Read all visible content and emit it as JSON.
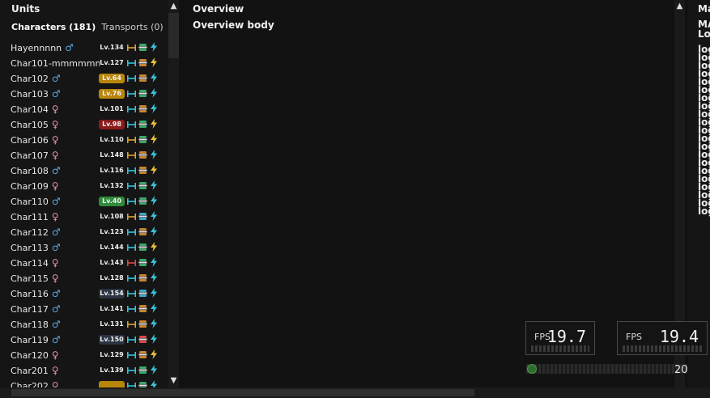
{
  "left_panel": {
    "title": "Units",
    "tabs": {
      "characters": "Characters (181)",
      "transports": "Transports (0)"
    },
    "scroll_up": "▲",
    "scroll_down": "▼"
  },
  "characters": [
    {
      "name": "Hayennnnn",
      "gender": "♂",
      "level": "Lv.134",
      "badge": "none",
      "range_color": "#d9a23a",
      "food_color": "#3aa86a",
      "bolt_color": "#39c2d8"
    },
    {
      "name": "Char101-mmmmmmmmm",
      "gender": "♂",
      "level": "Lv.127",
      "badge": "none",
      "range_color": "#39c2d8",
      "food_color": "#c8832f",
      "bolt_color": "#e8c23a"
    },
    {
      "name": "Char102",
      "gender": "♂",
      "level": "Lv.64",
      "badge": "gold",
      "range_color": "#39c2d8",
      "food_color": "#c8832f",
      "bolt_color": "#39c2d8"
    },
    {
      "name": "Char103",
      "gender": "♂",
      "level": "Lv.76",
      "badge": "gold",
      "range_color": "#39c2d8",
      "food_color": "#3aa86a",
      "bolt_color": "#39c2d8"
    },
    {
      "name": "Char104",
      "gender": "♀",
      "level": "Lv.101",
      "badge": "none",
      "range_color": "#39c2d8",
      "food_color": "#c8832f",
      "bolt_color": "#39c2d8"
    },
    {
      "name": "Char105",
      "gender": "♀",
      "level": "Lv.98",
      "badge": "red",
      "range_color": "#39c2d8",
      "food_color": "#3aa86a",
      "bolt_color": "#e8c23a"
    },
    {
      "name": "Char106",
      "gender": "♀",
      "level": "Lv.110",
      "badge": "none",
      "range_color": "#d9a23a",
      "food_color": "#3aa86a",
      "bolt_color": "#e8c23a"
    },
    {
      "name": "Char107",
      "gender": "♀",
      "level": "Lv.148",
      "badge": "none",
      "range_color": "#d9a23a",
      "food_color": "#c8832f",
      "bolt_color": "#39c2d8"
    },
    {
      "name": "Char108",
      "gender": "♂",
      "level": "Lv.116",
      "badge": "none",
      "range_color": "#39c2d8",
      "food_color": "#c8832f",
      "bolt_color": "#e8c23a"
    },
    {
      "name": "Char109",
      "gender": "♀",
      "level": "Lv.132",
      "badge": "none",
      "range_color": "#39c2d8",
      "food_color": "#3aa86a",
      "bolt_color": "#39c2d8"
    },
    {
      "name": "Char110",
      "gender": "♂",
      "level": "Lv.40",
      "badge": "green",
      "range_color": "#39c2d8",
      "food_color": "#3aa86a",
      "bolt_color": "#39c2d8"
    },
    {
      "name": "Char111",
      "gender": "♀",
      "level": "Lv.108",
      "badge": "none",
      "range_color": "#d9a23a",
      "food_color": "#39a8c8",
      "bolt_color": "#39c2d8"
    },
    {
      "name": "Char112",
      "gender": "♂",
      "level": "Lv.123",
      "badge": "none",
      "range_color": "#39c2d8",
      "food_color": "#c8832f",
      "bolt_color": "#39c2d8"
    },
    {
      "name": "Char113",
      "gender": "♂",
      "level": "Lv.144",
      "badge": "none",
      "range_color": "#39c2d8",
      "food_color": "#3aa86a",
      "bolt_color": "#e8c23a"
    },
    {
      "name": "Char114",
      "gender": "♀",
      "level": "Lv.143",
      "badge": "none",
      "range_color": "#d84a4a",
      "food_color": "#3aa86a",
      "bolt_color": "#39c2d8"
    },
    {
      "name": "Char115",
      "gender": "♀",
      "level": "Lv.128",
      "badge": "none",
      "range_color": "#39c2d8",
      "food_color": "#c8832f",
      "bolt_color": "#39c2d8"
    },
    {
      "name": "Char116",
      "gender": "♂",
      "level": "Lv.154",
      "badge": "dark",
      "range_color": "#39c2d8",
      "food_color": "#39a8c8",
      "bolt_color": "#39c2d8"
    },
    {
      "name": "Char117",
      "gender": "♂",
      "level": "Lv.141",
      "badge": "none",
      "range_color": "#39c2d8",
      "food_color": "#c8832f",
      "bolt_color": "#39c2d8"
    },
    {
      "name": "Char118",
      "gender": "♂",
      "level": "Lv.131",
      "badge": "none",
      "range_color": "#d9a23a",
      "food_color": "#c8832f",
      "bolt_color": "#39c2d8"
    },
    {
      "name": "Char119",
      "gender": "♂",
      "level": "Lv.150",
      "badge": "dark",
      "range_color": "#39c2d8",
      "food_color": "#d84a4a",
      "bolt_color": "#39c2d8"
    },
    {
      "name": "Char120",
      "gender": "♀",
      "level": "Lv.129",
      "badge": "none",
      "range_color": "#39c2d8",
      "food_color": "#c8832f",
      "bolt_color": "#e8c23a"
    },
    {
      "name": "Char201",
      "gender": "♀",
      "level": "Lv.139",
      "badge": "none",
      "range_color": "#39c2d8",
      "food_color": "#3aa86a",
      "bolt_color": "#39c2d8"
    },
    {
      "name": "Char202",
      "gender": "♀",
      "level": "",
      "badge": "gold",
      "range_color": "#39c2d8",
      "food_color": "#3aa86a",
      "bolt_color": "#39c2d8"
    }
  ],
  "colors": {
    "male": "#5aa8e6",
    "female": "#e38fb0",
    "badge_gold": "#b8860b",
    "badge_red": "#8b1a1a",
    "badge_green": "#2e8b3a",
    "badge_dark": "#2a3340"
  },
  "middle_panel": {
    "title": "Overview",
    "body": "Overview body",
    "scroll_up": "▲"
  },
  "right_panel": {
    "title": "Ma",
    "sub1": "MA",
    "sub2": "Lo",
    "log_lines": [
      "log",
      "log",
      "log",
      "log",
      "log",
      "log",
      "log",
      "log",
      "log",
      "log",
      "log",
      "log",
      "log",
      "log",
      "log",
      "log",
      "log",
      "log",
      "log",
      "log",
      "log"
    ]
  },
  "fps": [
    {
      "label": "FPS",
      "value": "19.7"
    },
    {
      "label": "FPS",
      "value": "19.4"
    }
  ],
  "slider": {
    "value": "20",
    "fraction": 0.0
  }
}
